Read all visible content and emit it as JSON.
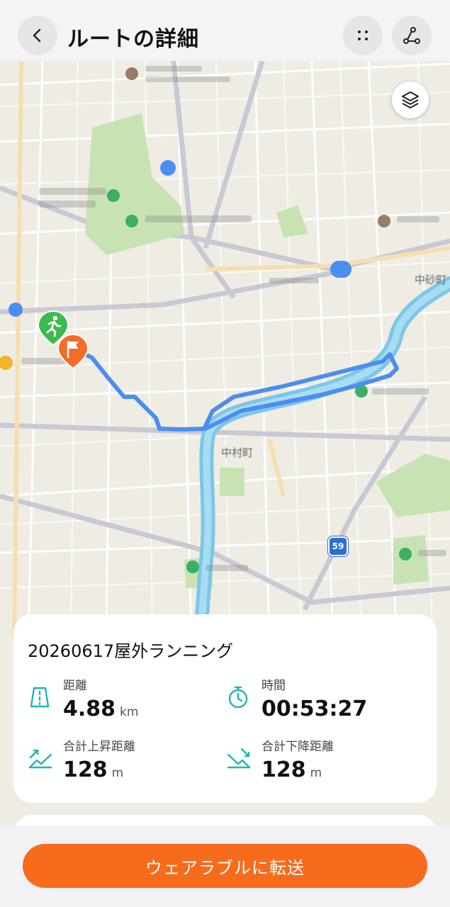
{
  "header": {
    "title": "ルートの詳細",
    "back_icon": "chevron-left-icon",
    "more_icon": "dots-grid-icon",
    "route_icon": "route-icon"
  },
  "map": {
    "layer_icon": "layers-icon",
    "route_color": "#4b8ef0",
    "start_color": "#3dba4e",
    "end_color": "#f56b2a",
    "road_badges": [
      "59"
    ],
    "place_labels": [
      "中村町",
      "中砂町"
    ]
  },
  "workout": {
    "title": "20260617屋外ランニング",
    "stats": [
      {
        "label": "距離",
        "value": "4.88",
        "unit": "km",
        "icon": "distance-icon"
      },
      {
        "label": "時間",
        "value": "00:53:27",
        "unit": "",
        "icon": "stopwatch-icon"
      },
      {
        "label": "合計上昇距離",
        "value": "128",
        "unit": "m",
        "icon": "ascent-icon"
      },
      {
        "label": "合計下降距離",
        "value": "128",
        "unit": "m",
        "icon": "descent-icon"
      }
    ]
  },
  "actions": {
    "transfer_label": "ウェアラブルに転送"
  },
  "colors": {
    "accent": "#f76b1c",
    "icon_teal": "#1fb5b5"
  }
}
